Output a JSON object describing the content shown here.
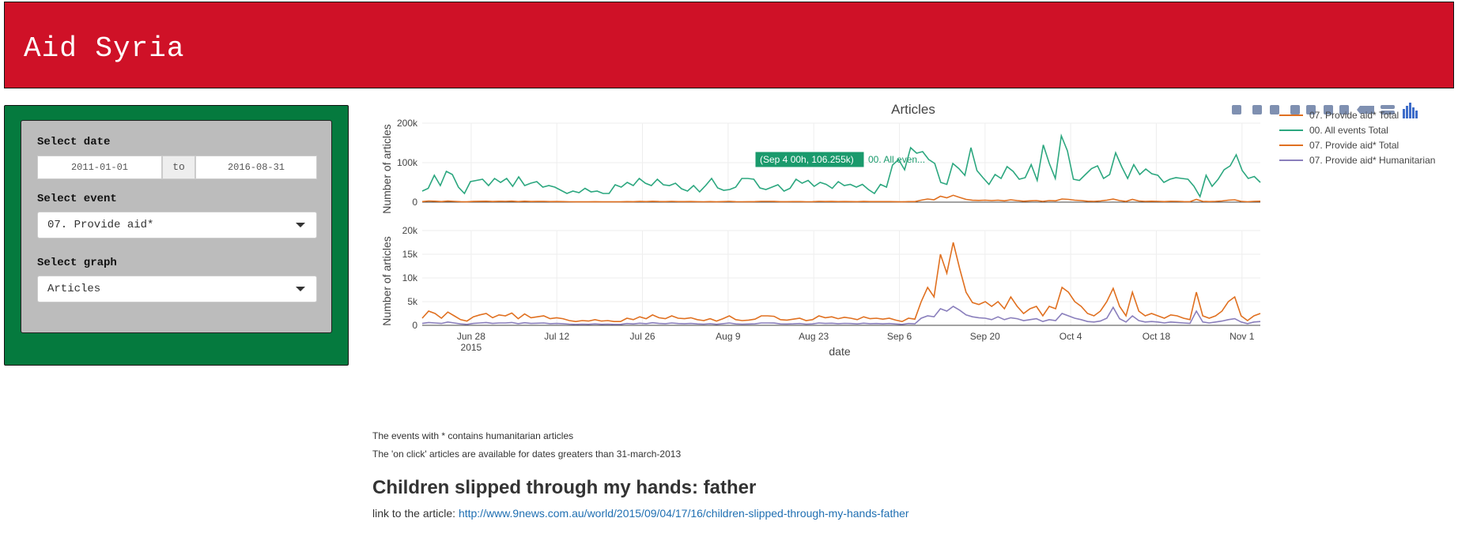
{
  "header": {
    "title": "Aid Syria",
    "bg_color": "#cf1127"
  },
  "sidebar": {
    "bg_color": "#057a3e",
    "date_label": "Select date",
    "date_start": "2011-01-01",
    "date_to": "to",
    "date_end": "2016-08-31",
    "event_label": "Select event",
    "event_value": "07. Provide aid*",
    "graph_label": "Select graph",
    "graph_value": "Articles"
  },
  "chart": {
    "title": "Articles",
    "ylabel": "Number of articles",
    "xlabel": "date",
    "toolbar": [
      "camera-icon",
      "zoom-icon",
      "pan-icon",
      "zoom-in-icon",
      "zoom-out-icon",
      "autoscale-icon",
      "home-icon",
      "spike-icon",
      "hover-compare-icon",
      "plotly-logo-icon"
    ],
    "legend": [
      "07. Provide aid*  Total",
      "00. All events Total",
      "07. Provide aid*  Total",
      "07. Provide aid* Humanitarian"
    ],
    "hover_label": "(Sep 4 00h, 106.255k)",
    "hover_series": "00. All even...",
    "x_ticks": [
      "Jun 28",
      "Jul 12",
      "Jul 26",
      "Aug 9",
      "Aug 23",
      "Sep 6",
      "Sep 20",
      "Oct 4",
      "Oct 18",
      "Nov 1"
    ],
    "x_year": "2015",
    "top_y_ticks": [
      "0",
      "100k",
      "200k"
    ],
    "bottom_y_ticks": [
      "0",
      "5k",
      "10k",
      "15k",
      "20k"
    ]
  },
  "chart_data": [
    {
      "type": "line",
      "title": "Articles",
      "x_range": [
        "2015-06-20",
        "2015-11-04"
      ],
      "ylabel": "Number of articles",
      "ylim": [
        0,
        200000
      ],
      "grid": true,
      "legend_position": "top-right",
      "series": [
        {
          "name": "00. All events Total",
          "color": "#2ca77f",
          "values": [
            28000,
            35000,
            68000,
            42000,
            78000,
            70000,
            38000,
            22000,
            52000,
            55000,
            58000,
            42000,
            60000,
            50000,
            60000,
            40000,
            64000,
            42000,
            48000,
            52000,
            38000,
            42000,
            38000,
            30000,
            22000,
            28000,
            24000,
            35000,
            26000,
            28000,
            22000,
            22000,
            44000,
            38000,
            50000,
            42000,
            60000,
            48000,
            42000,
            58000,
            44000,
            42000,
            48000,
            34000,
            28000,
            42000,
            26000,
            42000,
            60000,
            36000,
            30000,
            32000,
            38000,
            60000,
            60000,
            58000,
            36000,
            32000,
            38000,
            44000,
            28000,
            35000,
            58000,
            48000,
            55000,
            40000,
            50000,
            45000,
            35000,
            52000,
            42000,
            45000,
            38000,
            45000,
            32000,
            22000,
            45000,
            38000,
            94000,
            108000,
            82000,
            138000,
            124000,
            128000,
            108000,
            98000,
            50000,
            45000,
            98000,
            85000,
            68000,
            138000,
            80000,
            62000,
            45000,
            70000,
            60000,
            90000,
            78000,
            58000,
            62000,
            95000,
            55000,
            145000,
            98000,
            60000,
            168000,
            130000,
            58000,
            55000,
            70000,
            85000,
            92000,
            60000,
            70000,
            125000,
            90000,
            60000,
            95000,
            70000,
            84000,
            72000,
            68000,
            50000,
            58000,
            62000,
            60000,
            58000,
            40000,
            14000,
            68000,
            40000,
            58000,
            82000,
            92000,
            120000,
            80000,
            60000,
            65000,
            50000
          ]
        },
        {
          "name": "07. Provide aid*  Total",
          "color": "#e07020",
          "values": [
            1500,
            3000,
            2500,
            1500,
            2800,
            2000,
            1200,
            900,
            1800,
            2200,
            2500,
            1600,
            2200,
            2000,
            2600,
            1400,
            2400,
            1600,
            1800,
            2000,
            1400,
            1600,
            1400,
            1000,
            800,
            1000,
            900,
            1200,
            900,
            1000,
            800,
            800,
            1500,
            1200,
            1800,
            1400,
            2200,
            1600,
            1400,
            2000,
            1500,
            1400,
            1600,
            1200,
            1000,
            1400,
            900,
            1400,
            2000,
            1200,
            1000,
            1100,
            1300,
            2000,
            2000,
            1900,
            1200,
            1100,
            1300,
            1500,
            1000,
            1200,
            2000,
            1600,
            1800,
            1400,
            1700,
            1500,
            1200,
            1800,
            1400,
            1500,
            1300,
            1500,
            1100,
            800,
            1500,
            1300,
            5000,
            8000,
            6000,
            15000,
            11000,
            17500,
            12000,
            7000,
            4800,
            4400,
            5000,
            4000,
            5000,
            3500,
            6000,
            4000,
            2500,
            3500,
            4000,
            2000,
            4000,
            3500,
            8000,
            7000,
            5000,
            4000,
            2500,
            2000,
            3000,
            5000,
            7800,
            4000,
            2000,
            7000,
            3000,
            2000,
            2500,
            2000,
            1500,
            2200,
            2000,
            1500,
            1200,
            7000,
            2000,
            1500,
            2000,
            3000,
            5000,
            6000,
            2000,
            1000,
            2000,
            2500
          ]
        },
        {
          "name": "07. Provide aid* Humanitarian",
          "color": "#8a7fbc",
          "values": [
            400,
            600,
            500,
            400,
            700,
            500,
            300,
            200,
            400,
            500,
            600,
            400,
            500,
            500,
            600,
            350,
            550,
            400,
            450,
            500,
            350,
            400,
            350,
            250,
            200,
            250,
            220,
            300,
            220,
            250,
            200,
            200,
            380,
            300,
            450,
            350,
            550,
            400,
            350,
            500,
            380,
            350,
            400,
            300,
            250,
            350,
            220,
            350,
            500,
            300,
            250,
            280,
            320,
            500,
            500,
            480,
            300,
            280,
            320,
            380,
            250,
            300,
            500,
            400,
            450,
            350,
            420,
            380,
            300,
            450,
            350,
            380,
            320,
            380,
            280,
            200,
            380,
            320,
            1500,
            2000,
            1800,
            3500,
            3000,
            4000,
            3200,
            2200,
            1800,
            1600,
            1500,
            1200,
            1800,
            1200,
            1600,
            1400,
            1000,
            1200,
            1400,
            800,
            1200,
            1000,
            2500,
            2000,
            1500,
            1200,
            800,
            700,
            900,
            1500,
            3800,
            1400,
            700,
            2000,
            1000,
            700,
            800,
            700,
            500,
            700,
            600,
            500,
            400,
            3000,
            700,
            500,
            700,
            900,
            1200,
            1400,
            700,
            350,
            700,
            800
          ]
        }
      ]
    }
  ],
  "notes": {
    "line1": "The events with * contains humanitarian articles",
    "line2": "The 'on click' articles are available for dates greaters than 31-march-2013"
  },
  "article": {
    "title": "Children slipped through my hands: father",
    "link_prefix": "link to the article: ",
    "link_url": "http://www.9news.com.au/world/2015/09/04/17/16/children-slipped-through-my-hands-father"
  }
}
